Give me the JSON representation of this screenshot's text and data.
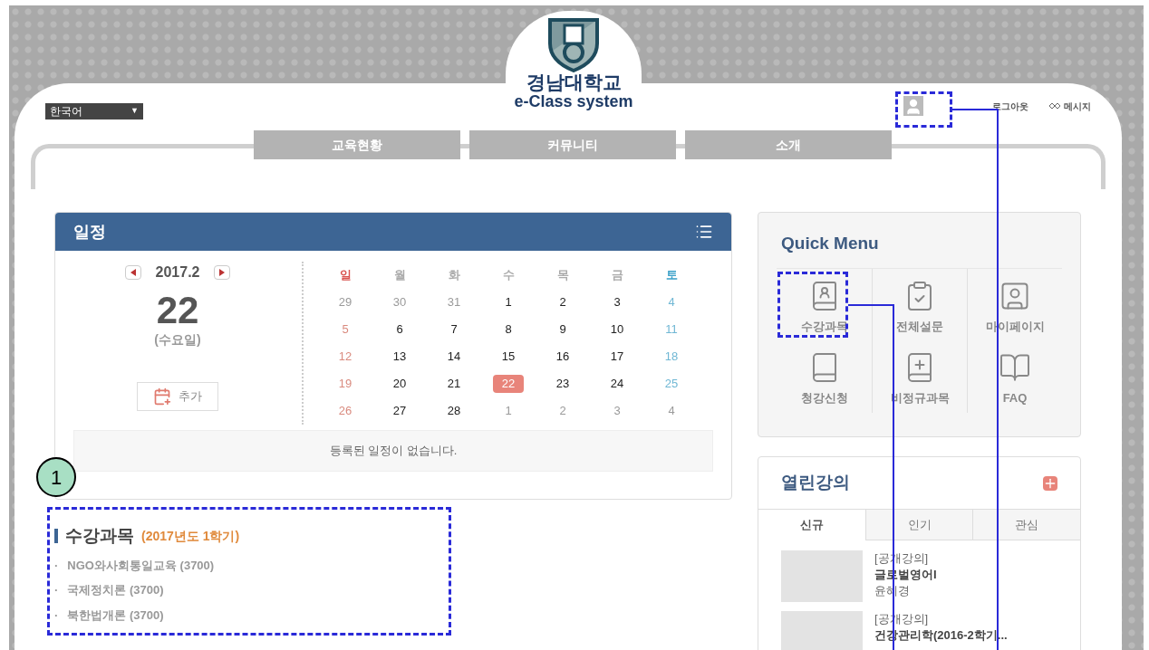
{
  "header": {
    "language": "한국어",
    "language_caret": "▼",
    "logo_line1": "경남대학교",
    "logo_line2": "e-Class system",
    "logout": "로그아웃",
    "messages": "메시지"
  },
  "nav": [
    "교육현황",
    "커뮤니티",
    "소개"
  ],
  "schedule": {
    "title": "일정",
    "month": "2017.2",
    "day": "22",
    "weekday": "(수요일)",
    "add": "추가",
    "empty": "등록된 일정이 없습니다.",
    "weekdays": [
      {
        "label": "일",
        "kind": "sun"
      },
      {
        "label": "월",
        "kind": "weekday"
      },
      {
        "label": "화",
        "kind": "weekday"
      },
      {
        "label": "수",
        "kind": "weekday"
      },
      {
        "label": "목",
        "kind": "weekday"
      },
      {
        "label": "금",
        "kind": "weekday"
      },
      {
        "label": "토",
        "kind": "sat"
      }
    ],
    "weeks": [
      [
        {
          "label": "29",
          "muted": true,
          "selected": false
        },
        {
          "label": "30",
          "muted": true,
          "selected": false
        },
        {
          "label": "31",
          "muted": true,
          "selected": false
        },
        {
          "label": "1",
          "muted": false,
          "selected": false
        },
        {
          "label": "2",
          "muted": false,
          "selected": false
        },
        {
          "label": "3",
          "muted": false,
          "selected": false
        },
        {
          "label": "4",
          "muted": false,
          "selected": false
        }
      ],
      [
        {
          "label": "5",
          "muted": false,
          "selected": false
        },
        {
          "label": "6",
          "muted": false,
          "selected": false
        },
        {
          "label": "7",
          "muted": false,
          "selected": false
        },
        {
          "label": "8",
          "muted": false,
          "selected": false
        },
        {
          "label": "9",
          "muted": false,
          "selected": false
        },
        {
          "label": "10",
          "muted": false,
          "selected": false
        },
        {
          "label": "11",
          "muted": false,
          "selected": false
        }
      ],
      [
        {
          "label": "12",
          "muted": false,
          "selected": false
        },
        {
          "label": "13",
          "muted": false,
          "selected": false
        },
        {
          "label": "14",
          "muted": false,
          "selected": false
        },
        {
          "label": "15",
          "muted": false,
          "selected": false
        },
        {
          "label": "16",
          "muted": false,
          "selected": false
        },
        {
          "label": "17",
          "muted": false,
          "selected": false
        },
        {
          "label": "18",
          "muted": false,
          "selected": false
        }
      ],
      [
        {
          "label": "19",
          "muted": false,
          "selected": false
        },
        {
          "label": "20",
          "muted": false,
          "selected": false
        },
        {
          "label": "21",
          "muted": false,
          "selected": false
        },
        {
          "label": "22",
          "muted": false,
          "selected": true
        },
        {
          "label": "23",
          "muted": false,
          "selected": false
        },
        {
          "label": "24",
          "muted": false,
          "selected": false
        },
        {
          "label": "25",
          "muted": false,
          "selected": false
        }
      ],
      [
        {
          "label": "26",
          "muted": false,
          "selected": false
        },
        {
          "label": "27",
          "muted": false,
          "selected": false
        },
        {
          "label": "28",
          "muted": false,
          "selected": false
        },
        {
          "label": "1",
          "muted": true,
          "selected": false
        },
        {
          "label": "2",
          "muted": true,
          "selected": false
        },
        {
          "label": "3",
          "muted": true,
          "selected": false
        },
        {
          "label": "4",
          "muted": true,
          "selected": false
        }
      ]
    ]
  },
  "courses": {
    "title": "수강과목",
    "term": "(2017년도 1학기)",
    "bullet": "·",
    "items": [
      "NGO와사회통일교육 (3700)",
      "국제정치론 (3700)",
      "북한법개론 (3700)"
    ]
  },
  "quick_menu": {
    "title": "Quick Menu",
    "items": [
      "수강과목",
      "전체설문",
      "마이페이지",
      "청강신청",
      "비정규과목",
      "FAQ"
    ]
  },
  "open_lectures": {
    "title": "열린강의",
    "tabs": [
      {
        "label": "신규",
        "selected": true
      },
      {
        "label": "인기",
        "selected": false
      },
      {
        "label": "관심",
        "selected": false
      }
    ],
    "items": [
      {
        "tag": "[공개강의]",
        "title": "글로벌영어I",
        "author": "윤혜경"
      },
      {
        "tag": "[공개강의]",
        "title": "건강관리학(2016-2학기..."
      }
    ]
  },
  "annotation": {
    "number": "1"
  }
}
